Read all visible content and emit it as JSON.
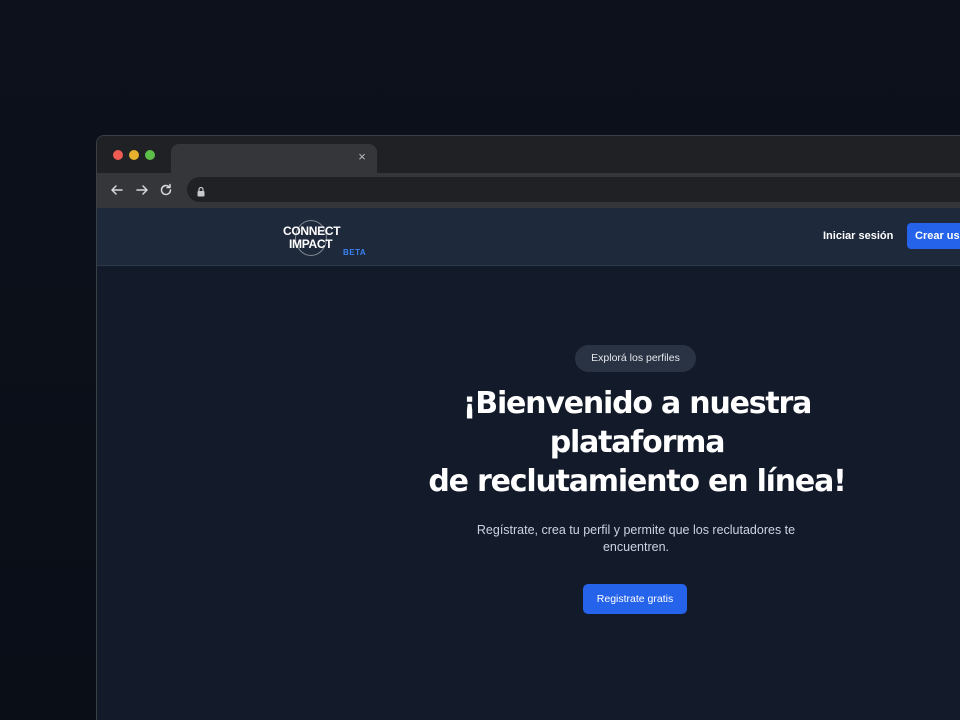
{
  "browser": {
    "tab_close": "×",
    "icons": {
      "back": "arrow-left-icon",
      "forward": "arrow-right-icon",
      "reload": "reload-icon",
      "lock": "lock-icon"
    }
  },
  "header": {
    "logo_line1": "CONNECT",
    "logo_line2": "IMPACT",
    "logo_badge": "BETA",
    "login_label": "Iniciar sesión",
    "create_label": "Crear usuario"
  },
  "hero": {
    "pill_label": "Explorá los perfiles",
    "headline_lines": [
      "¡Bienvenido a nuestra",
      "plataforma",
      "de reclutamiento en línea!"
    ],
    "subtitle": "Regístrate, crea tu perfil y permite que los reclutadores te encuentren.",
    "cta_label": "Registrate gratis"
  },
  "colors": {
    "accent": "#2563eb",
    "header_bg": "#1e293b",
    "hero_bg": "#131a2a",
    "beta": "#3b82f6"
  }
}
